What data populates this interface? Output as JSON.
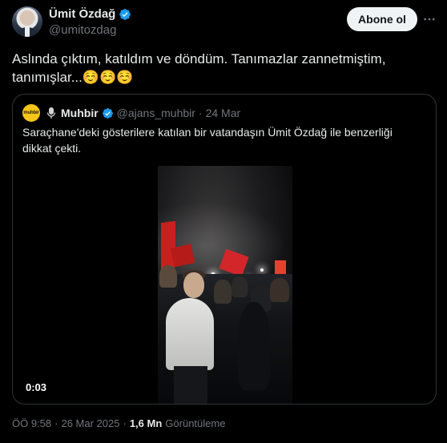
{
  "author": {
    "display_name": "Ümit Özdağ",
    "handle": "@umitozdag",
    "verified": true
  },
  "follow_button_label": "Abone ol",
  "more_icon": "more-horizontal-icon",
  "tweet_text": "Aslında çıktım, katıldım ve döndüm. Tanımazlar zannetmiştim, tanımışlar...☺️☺️☺️",
  "quote": {
    "avatar_text": "muhbir",
    "display_name": "Muhbir",
    "handle": "@ajans_muhbir",
    "separator": "·",
    "date": "24 Mar",
    "text": "Saraçhane'deki gösterilere katılan bir vatandaşın Ümit Özdağ ile benzerliği dikkat çekti.",
    "video_timer": "0:03"
  },
  "meta": {
    "time": "ÖÖ 9:58",
    "separator": "·",
    "date": "26 Mar 2025",
    "separator2": "·",
    "views_count": "1,6 Mn",
    "views_label": "Görüntüleme"
  },
  "colors": {
    "background": "#000000",
    "text": "#e7e9ea",
    "muted": "#71767b",
    "verified": "#1d9bf0",
    "border": "#2f3336"
  }
}
